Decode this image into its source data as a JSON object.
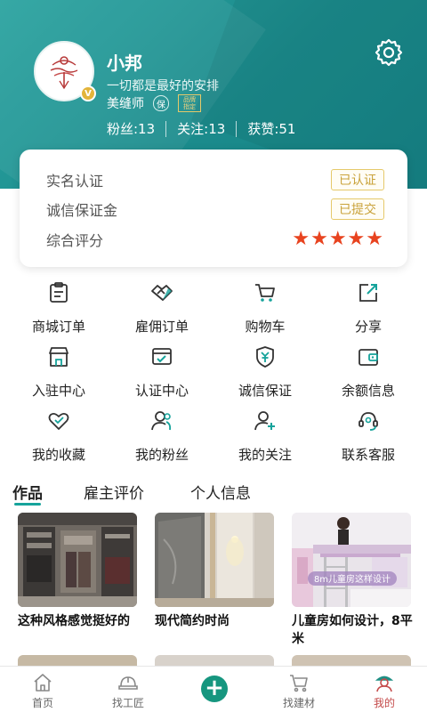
{
  "profile": {
    "name": "小邦",
    "motto": "一切都是最好的安排",
    "role": "美缝师",
    "guarantee_icon_text": "保",
    "brand_badge": "品牌指定",
    "stats": {
      "fans": "粉丝:13",
      "following": "关注:13",
      "likes": "获赞:51"
    }
  },
  "verification_card": {
    "rows": [
      {
        "label": "实名认证",
        "status": "已认证"
      },
      {
        "label": "诚信保证金",
        "status": "已提交"
      },
      {
        "label": "综合评分",
        "stars": "★★★★★"
      }
    ]
  },
  "menu": [
    {
      "label": "商城订单",
      "icon": "clipboard-icon"
    },
    {
      "label": "雇佣订单",
      "icon": "handshake-icon"
    },
    {
      "label": "购物车",
      "icon": "cart-icon"
    },
    {
      "label": "分享",
      "icon": "share-icon"
    },
    {
      "label": "入驻中心",
      "icon": "store-icon"
    },
    {
      "label": "认证中心",
      "icon": "certificate-icon"
    },
    {
      "label": "诚信保证",
      "icon": "shield-yen-icon"
    },
    {
      "label": "余额信息",
      "icon": "wallet-icon"
    },
    {
      "label": "我的收藏",
      "icon": "heart-icon"
    },
    {
      "label": "我的粉丝",
      "icon": "fans-icon"
    },
    {
      "label": "我的关注",
      "icon": "follow-user-icon"
    },
    {
      "label": "联系客服",
      "icon": "headset-icon"
    }
  ],
  "tabs": [
    {
      "label": "作品",
      "active": true
    },
    {
      "label": "雇主评价",
      "active": false
    },
    {
      "label": "个人信息",
      "active": false
    }
  ],
  "works": [
    {
      "title": "这种风格感觉挺好的"
    },
    {
      "title": "现代简约时尚"
    },
    {
      "title": "儿童房如何设计，8平米",
      "overlay": "8m儿童房这样设计"
    }
  ],
  "bottom_nav": [
    {
      "label": "首页",
      "icon": "home-icon",
      "active": false
    },
    {
      "label": "找工匠",
      "icon": "helmet-icon",
      "active": false
    },
    {
      "label": "",
      "icon": "plus-icon",
      "active": false
    },
    {
      "label": "找建材",
      "icon": "cart-icon",
      "active": false
    },
    {
      "label": "我的",
      "icon": "profile-icon",
      "active": true
    }
  ],
  "colors": {
    "header": "#1b8b8c",
    "accent": "#16a39b",
    "gold": "#c9a23a",
    "star": "#e8431f",
    "nav_active": "#c44a4a"
  }
}
